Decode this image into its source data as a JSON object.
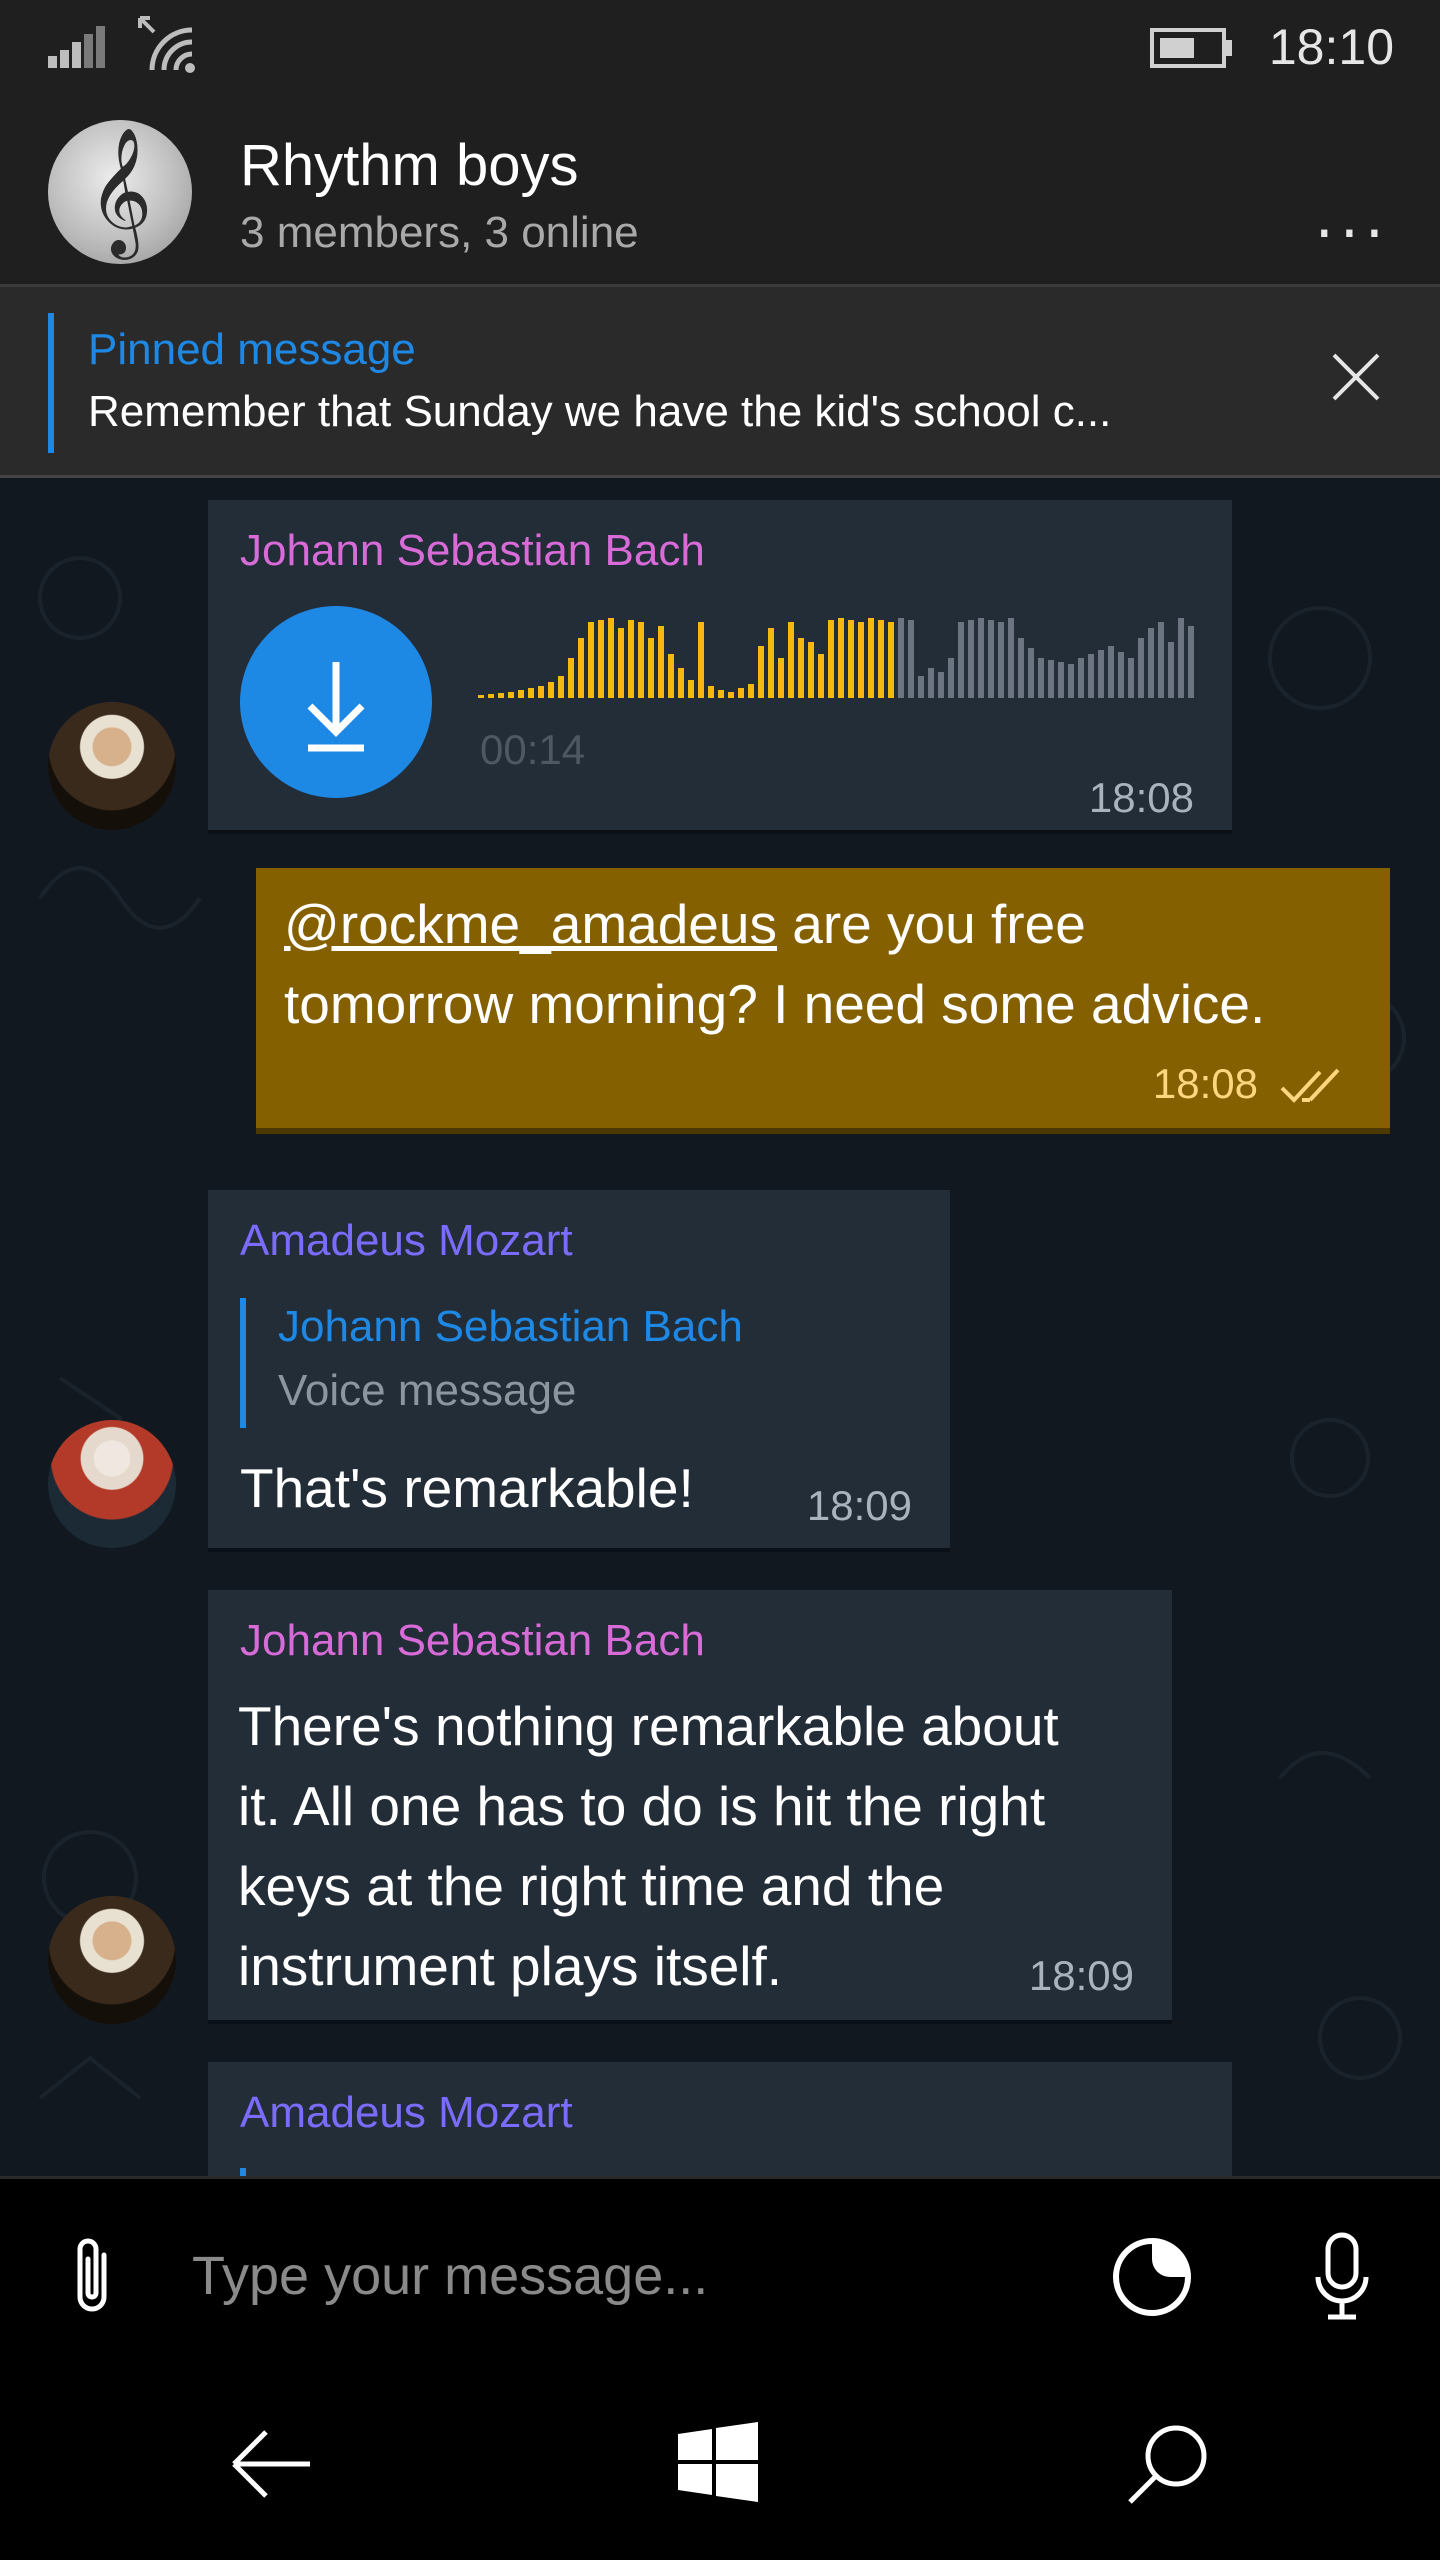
{
  "status_bar": {
    "time": "18:10"
  },
  "header": {
    "title": "Rhythm boys",
    "subtitle": "3 members, 3 online",
    "more_label": "..."
  },
  "pinned": {
    "title": "Pinned message",
    "text": "Remember that Sunday we have the kid's school c..."
  },
  "messages": [
    {
      "sender": "Johann Sebastian Bach",
      "type": "voice",
      "duration": "00:14",
      "time": "18:08"
    },
    {
      "sender": "me",
      "mention": "@rockme_amadeus",
      "line1_rest": " are you free",
      "line2": "tomorrow morning? I need some advice.",
      "time": "18:08"
    },
    {
      "sender": "Amadeus Mozart",
      "reply_to": "Johann Sebastian Bach",
      "reply_text": "Voice message",
      "text": "That's remarkable!",
      "time": "18:09"
    },
    {
      "sender": "Johann Sebastian Bach",
      "lines": [
        "There's nothing remarkable about",
        "it. All one has to do is hit the right",
        "keys at the right time and the",
        "instrument plays itself."
      ],
      "time": "18:09"
    },
    {
      "sender": "Amadeus Mozart"
    }
  ],
  "input": {
    "placeholder": "Type your message..."
  },
  "colors": {
    "accent": "#1e88e5",
    "own_bubble": "#846000",
    "bubble": "#232d38",
    "bach_name": "#d86bd8",
    "mozart_name": "#7b6cff",
    "waveform_played": "#f5b80f",
    "waveform_unplayed": "#6b7480"
  },
  "icons": {
    "download": "download-icon",
    "attach": "paperclip-icon",
    "sticker": "sticker-icon",
    "mic": "microphone-icon",
    "back": "back-arrow-icon",
    "home": "windows-logo-icon",
    "search": "search-icon"
  }
}
